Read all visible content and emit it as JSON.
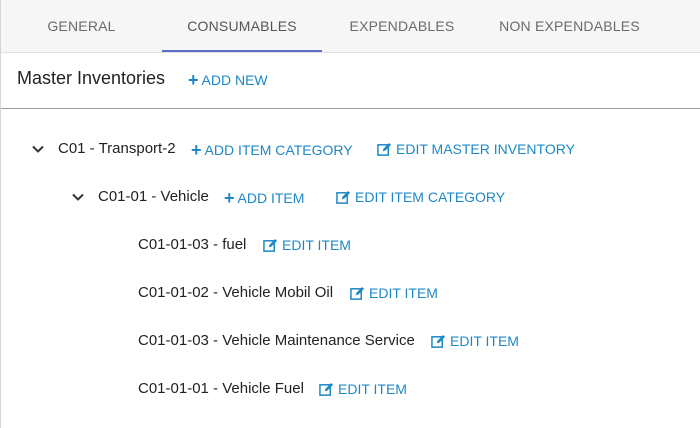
{
  "tabs": [
    {
      "label": "GENERAL"
    },
    {
      "label": "CONSUMABLES"
    },
    {
      "label": "EXPENDABLES"
    },
    {
      "label": "NON EXPENDABLES"
    }
  ],
  "active_tab": "CONSUMABLES",
  "header": {
    "title": "Master Inventories",
    "add_new_label": "ADD NEW"
  },
  "tree": {
    "root": {
      "label": "C01 - Transport-2",
      "add_action": "ADD ITEM CATEGORY",
      "edit_action": "EDIT MASTER INVENTORY"
    },
    "category": {
      "label": "C01-01 - Vehicle",
      "add_action": "ADD ITEM",
      "edit_action": "EDIT ITEM CATEGORY"
    },
    "items": [
      {
        "label": "C01-01-03 - fuel",
        "edit_action": "EDIT ITEM"
      },
      {
        "label": "C01-01-02 - Vehicle Mobil Oil",
        "edit_action": "EDIT ITEM"
      },
      {
        "label": "C01-01-03 - Vehicle Maintenance Service",
        "edit_action": "EDIT ITEM"
      },
      {
        "label": "C01-01-01 - Vehicle Fuel",
        "edit_action": "EDIT ITEM"
      }
    ]
  },
  "colors": {
    "link": "#1e88c7",
    "active_tab_underline": "#5b6ec9"
  }
}
